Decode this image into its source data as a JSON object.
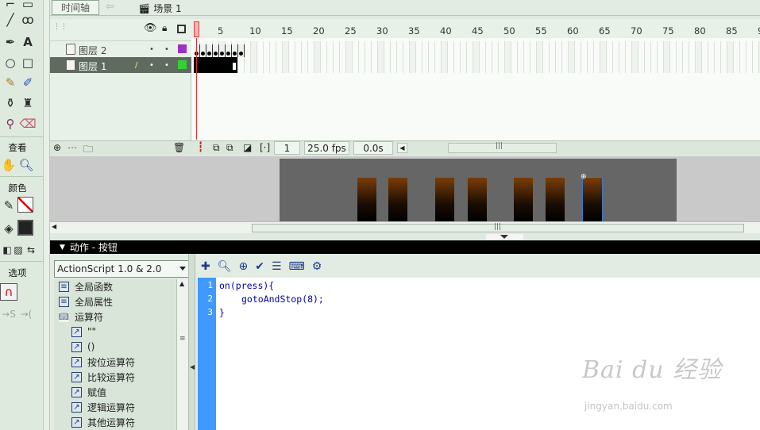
{
  "timeline": {
    "button_label": "时间轴",
    "back_icon": "left-arrow-icon",
    "scene_label": "场景 1",
    "ruler_ticks": [
      "1",
      "5",
      "10",
      "15",
      "20",
      "25",
      "30",
      "35",
      "40",
      "45",
      "50",
      "55",
      "60",
      "65",
      "70",
      "75",
      "80",
      "85",
      "9"
    ],
    "layers": [
      {
        "name": "图层 2"
      },
      {
        "name": "图层 1"
      }
    ],
    "current_frame": "1",
    "fps": "25.0 fps",
    "elapsed": "0.0s",
    "playhead_color": "#dd3030"
  },
  "tools": {
    "view_label": "查看",
    "colors_label": "颜色",
    "options_label": "选项"
  },
  "actions": {
    "panel_title": "动作 - 按钮",
    "script_version": "ActionScript 1.0 & 2.0",
    "tree": [
      {
        "label": "全局函数",
        "level": 0
      },
      {
        "label": "全局属性",
        "level": 0
      },
      {
        "label": "运算符",
        "level": 0
      },
      {
        "label": "\"\"",
        "level": 1
      },
      {
        "label": "()",
        "level": 1
      },
      {
        "label": "按位运算符",
        "level": 1
      },
      {
        "label": "比较运算符",
        "level": 1
      },
      {
        "label": "赋值",
        "level": 1
      },
      {
        "label": "逻辑运算符",
        "level": 1
      },
      {
        "label": "其他运算符",
        "level": 1
      }
    ],
    "code_lines": [
      {
        "num": "1",
        "text": "on(press){"
      },
      {
        "num": "2",
        "text": "gotoAndStop(8);"
      },
      {
        "num": "3",
        "text": "}"
      }
    ]
  },
  "watermark": {
    "main": "Bai du 经验",
    "sub": "jingyan.baidu.com"
  }
}
